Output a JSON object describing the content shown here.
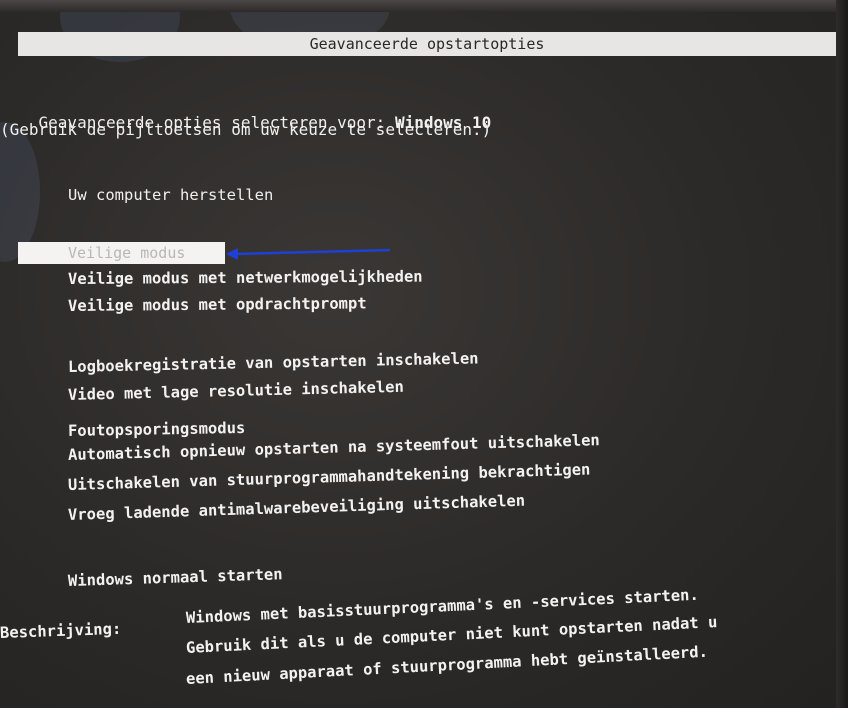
{
  "title": "Geavanceerde opstartopties",
  "header": {
    "line1_prefix": "Geavanceerde opties selecteren voor: ",
    "line1_os": "Windows 10",
    "line2": "(Gebruik de pijltoetsen om uw keuze te selecteren.)"
  },
  "repair": "Uw computer herstellen",
  "selected_option": "Veilige modus",
  "safe_options": [
    "Veilige modus met netwerkmogelijkheden",
    "Veilige modus met opdrachtprompt"
  ],
  "advanced_options": [
    "Logboekregistratie van opstarten inschakelen",
    "Video met lage resolutie inschakelen",
    "Foutopsporingsmodus",
    "Automatisch opnieuw opstarten na systeemfout uitschakelen",
    "Uitschakelen van stuurprogrammahandtekening bekrachtigen",
    "Vroeg ladende antimalwarebeveiliging uitschakelen"
  ],
  "normal_start": "Windows normaal starten",
  "description": {
    "label": "Beschrijving:",
    "lines": [
      "Windows met basisstuurprogramma's en -services starten.",
      "Gebruik dit als u de computer niet kunt opstarten nadat u",
      "een nieuw apparaat of stuurprogramma hebt geïnstalleerd."
    ]
  },
  "colors": {
    "arrow": "#1f3fd6",
    "highlight": "#f4f3f2",
    "screen": "#2c2a28"
  }
}
